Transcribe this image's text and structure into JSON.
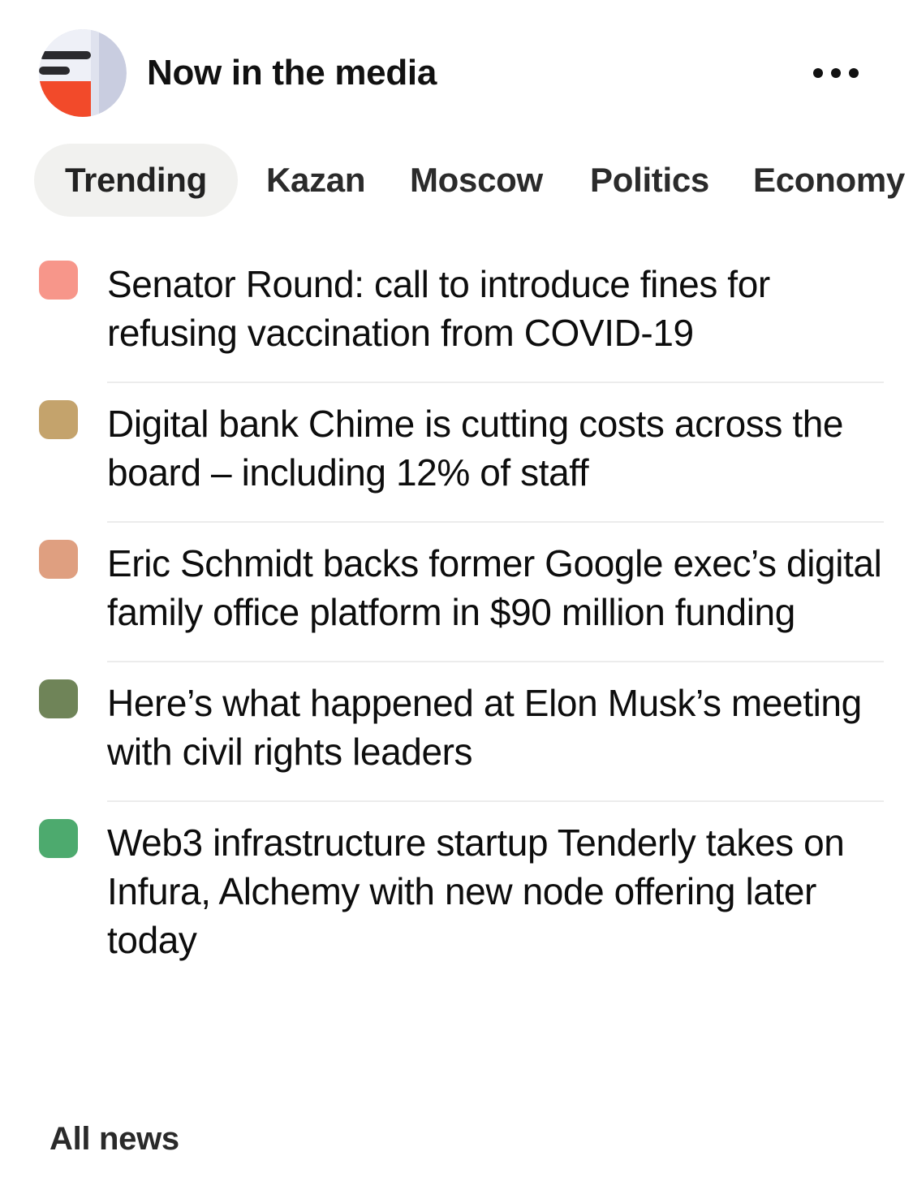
{
  "header": {
    "logo_icon": "media-logo-icon",
    "title": "Now in the media",
    "more_icon": "more-horizontal-icon"
  },
  "tabs": [
    {
      "label": "Trending",
      "active": true
    },
    {
      "label": "Kazan",
      "active": false
    },
    {
      "label": "Moscow",
      "active": false
    },
    {
      "label": "Politics",
      "active": false
    },
    {
      "label": "Economy",
      "active": false
    }
  ],
  "news": [
    {
      "title": "Senator Round: call to introduce fines for refusing vaccination from COVID-19",
      "color": "#f7968a"
    },
    {
      "title": "Digital bank Chime is cutting costs across the board – including 12% of staff",
      "color": "#c4a36c"
    },
    {
      "title": "Eric Schmidt backs former Google exec’s digital family office platform in $90 million funding",
      "color": "#df9f80"
    },
    {
      "title": "Here’s what happened at Elon Musk’s meeting with civil rights leaders",
      "color": "#6f8458"
    },
    {
      "title": "Web3 infrastructure startup Tenderly takes on Infura, Alchemy with new node offering later today",
      "color": "#4daa6e"
    }
  ],
  "footer": {
    "all_news_label": "All news"
  }
}
